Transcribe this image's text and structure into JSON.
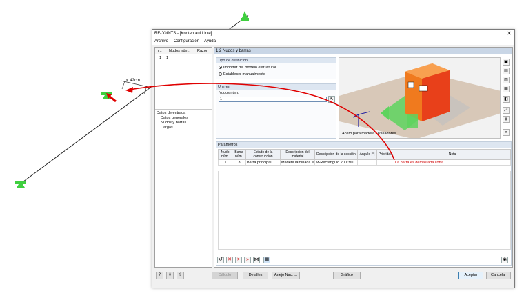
{
  "dialog": {
    "title": "RF-JOINTS - [Knoten auf Linie]",
    "close_symbol": "✕",
    "menu": [
      "Archivo",
      "Configuración",
      "Ayuda"
    ]
  },
  "left_panel": {
    "columns": [
      "n...",
      "Nudos núm.",
      "Razón"
    ],
    "row": [
      "1",
      "1"
    ],
    "tree_root": "Datos de entrada",
    "tree_items": [
      "Datos generales",
      "Nudos y barras",
      "Cargas"
    ]
  },
  "right_panel": {
    "header": "1.2 Nudos y barras",
    "definition": {
      "title": "Tipo de definición",
      "option1": "Importar del modelo estructural",
      "option2": "Establecer manualmente",
      "selected": "Importar del modelo estructural"
    },
    "union": {
      "title": "Unir en",
      "label": "Nudos núm.",
      "value": "1"
    },
    "view_caption": "Acero para madera - Pasadores",
    "parameters": {
      "title": "Parámetros",
      "columns": [
        "Nudo núm.",
        "Barra núm.",
        "Estado de la construcción",
        "Descripción del material",
        "Descripción de la sección",
        "Ángulo [°]",
        "Prioridad",
        "Nota"
      ],
      "rows": [
        [
          "1",
          "3",
          "Barra principal",
          "Madera laminada e",
          "M-Rectángulo 200/360",
          "",
          "",
          "La barra es demasiada corta"
        ]
      ]
    }
  },
  "buttons": {
    "calculo": "Cálculo",
    "detalles": "Detalles",
    "anejo": "Anejo Nac. ...",
    "grafico": "Gráfico",
    "aceptar": "Aceptar",
    "cancelar": "Cancelar"
  },
  "annotations": {
    "dimension": "< 42cm"
  },
  "colors": {
    "accent_red": "#d00000",
    "support_green": "#3fcf3f",
    "box_orange": "#f07a1e",
    "panel_header": "#c9d6e6"
  }
}
